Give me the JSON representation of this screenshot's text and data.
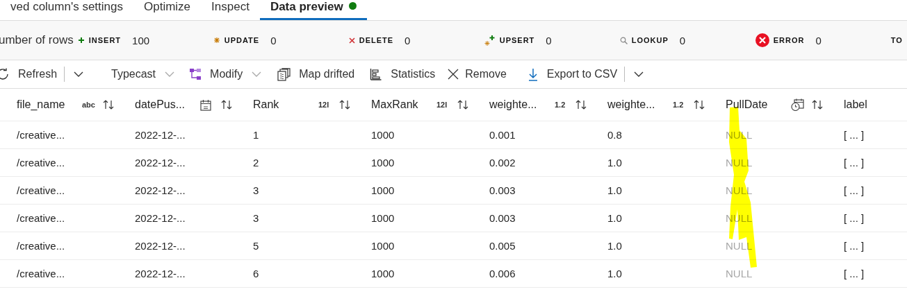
{
  "tabs": [
    {
      "label": "ved column's settings",
      "selected": false,
      "dot": false
    },
    {
      "label": "Optimize",
      "selected": false,
      "dot": false
    },
    {
      "label": "Inspect",
      "selected": false,
      "dot": false
    },
    {
      "label": "Data preview",
      "selected": true,
      "dot": true
    }
  ],
  "summary": {
    "label": "umber of rows",
    "counters": [
      {
        "kind": "insert",
        "label": "INSERT",
        "value": "100"
      },
      {
        "kind": "update",
        "label": "UPDATE",
        "value": "0"
      },
      {
        "kind": "delete",
        "label": "DELETE",
        "value": "0"
      },
      {
        "kind": "upsert",
        "label": "UPSERT",
        "value": "0"
      },
      {
        "kind": "lookup",
        "label": "LOOKUP",
        "value": "0"
      },
      {
        "kind": "error",
        "label": "ERROR",
        "value": "0"
      },
      {
        "kind": "total",
        "label": "TO"
      }
    ]
  },
  "toolbar": [
    {
      "kind": "refresh",
      "label": "Refresh"
    },
    {
      "kind": "separator"
    },
    {
      "kind": "more"
    },
    {
      "kind": "typecast",
      "label": "Typecast",
      "menu": true
    },
    {
      "kind": "modify",
      "label": "Modify",
      "menu": true
    },
    {
      "kind": "map",
      "label": "Map drifted"
    },
    {
      "kind": "statistics",
      "label": "Statistics"
    },
    {
      "kind": "remove",
      "label": "Remove"
    },
    {
      "kind": "export",
      "label": "Export to CSV"
    },
    {
      "kind": "separator"
    },
    {
      "kind": "more"
    }
  ],
  "table": {
    "columns": [
      {
        "name": "file_name",
        "kind": "text",
        "type_badge": "abc",
        "sortable": true
      },
      {
        "name": "datePus...",
        "kind": "date",
        "sortable": true
      },
      {
        "name": "Rank",
        "kind": "integer",
        "type_badge": "12l",
        "sortable": true
      },
      {
        "name": "MaxRank",
        "kind": "integer",
        "type_badge": "12l",
        "sortable": true
      },
      {
        "name": "weighte...",
        "kind": "decimal",
        "type_badge": "1.2",
        "sortable": true
      },
      {
        "name": "weighte...",
        "kind": "decimal",
        "type_badge": "1.2",
        "sortable": true
      },
      {
        "name": "PullDate",
        "kind": "datetime",
        "sortable": true
      },
      {
        "name": "label",
        "kind": "complex",
        "sortable": false
      }
    ],
    "rows": [
      [
        {
          "text": "/creative...",
          "null": false
        },
        {
          "text": "2022-12-...",
          "null": false
        },
        {
          "text": "1",
          "null": false
        },
        {
          "text": "1000",
          "null": false
        },
        {
          "text": "0.001",
          "null": false
        },
        {
          "text": "0.8",
          "null": false
        },
        {
          "text": "NULL",
          "null": true
        },
        {
          "text": "[ ... ]",
          "null": false
        }
      ],
      [
        {
          "text": "/creative...",
          "null": false
        },
        {
          "text": "2022-12-...",
          "null": false
        },
        {
          "text": "2",
          "null": false
        },
        {
          "text": "1000",
          "null": false
        },
        {
          "text": "0.002",
          "null": false
        },
        {
          "text": "1.0",
          "null": false
        },
        {
          "text": "NULL",
          "null": true
        },
        {
          "text": "[ ... ]",
          "null": false
        }
      ],
      [
        {
          "text": "/creative...",
          "null": false
        },
        {
          "text": "2022-12-...",
          "null": false
        },
        {
          "text": "3",
          "null": false
        },
        {
          "text": "1000",
          "null": false
        },
        {
          "text": "0.003",
          "null": false
        },
        {
          "text": "1.0",
          "null": false
        },
        {
          "text": "NULL",
          "null": true
        },
        {
          "text": "[ ... ]",
          "null": false
        }
      ],
      [
        {
          "text": "/creative...",
          "null": false
        },
        {
          "text": "2022-12-...",
          "null": false
        },
        {
          "text": "3",
          "null": false
        },
        {
          "text": "1000",
          "null": false
        },
        {
          "text": "0.003",
          "null": false
        },
        {
          "text": "1.0",
          "null": false
        },
        {
          "text": "NULL",
          "null": true
        },
        {
          "text": "[ ... ]",
          "null": false
        }
      ],
      [
        {
          "text": "/creative...",
          "null": false
        },
        {
          "text": "2022-12-...",
          "null": false
        },
        {
          "text": "5",
          "null": false
        },
        {
          "text": "1000",
          "null": false
        },
        {
          "text": "0.005",
          "null": false
        },
        {
          "text": "1.0",
          "null": false
        },
        {
          "text": "NULL",
          "null": true
        },
        {
          "text": "[ ... ]",
          "null": false
        }
      ],
      [
        {
          "text": "/creative...",
          "null": false
        },
        {
          "text": "2022-12-...",
          "null": false
        },
        {
          "text": "6",
          "null": false
        },
        {
          "text": "1000",
          "null": false
        },
        {
          "text": "0.006",
          "null": false
        },
        {
          "text": "1.0",
          "null": false
        },
        {
          "text": "NULL",
          "null": true
        },
        {
          "text": "[ ... ]",
          "null": false
        }
      ]
    ]
  }
}
